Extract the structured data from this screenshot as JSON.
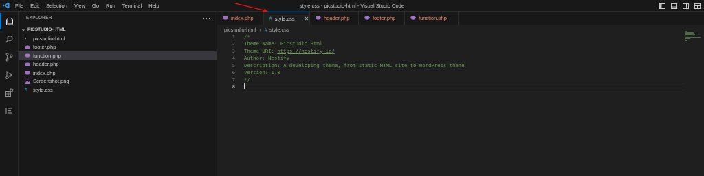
{
  "window": {
    "title": "style.css - picstudio-html - Visual Studio Code"
  },
  "menu": [
    "File",
    "Edit",
    "Selection",
    "View",
    "Go",
    "Run",
    "Terminal",
    "Help"
  ],
  "sidebar": {
    "title": "EXPLORER",
    "more": "···",
    "folder": "PICSTUDIO-HTML",
    "items": [
      {
        "label": "picstudio-html",
        "icon": "chevron-right-icon"
      },
      {
        "label": "footer.php",
        "icon": "php-icon"
      },
      {
        "label": "function.php",
        "icon": "php-icon"
      },
      {
        "label": "header.php",
        "icon": "php-icon"
      },
      {
        "label": "index.php",
        "icon": "php-icon"
      },
      {
        "label": "Screenshot.png",
        "icon": "image-icon"
      },
      {
        "label": "style.css",
        "icon": "css-icon"
      }
    ]
  },
  "tabs": [
    {
      "label": "index.php",
      "type": "php"
    },
    {
      "label": "style.css",
      "type": "css",
      "active": true
    },
    {
      "label": "header.php",
      "type": "php"
    },
    {
      "label": "footer.php",
      "type": "php"
    },
    {
      "label": "function.php",
      "type": "php"
    }
  ],
  "breadcrumb": {
    "folder": "picstudio-html",
    "file": "style.css"
  },
  "editor": {
    "lines": [
      {
        "num": "1",
        "text": "/*"
      },
      {
        "num": "2",
        "text": "Theme Name: Picstudio Html"
      },
      {
        "num": "3",
        "text_prefix": "Theme URI: ",
        "link": "https://nestify.io/"
      },
      {
        "num": "4",
        "text": "Author: Nestify"
      },
      {
        "num": "5",
        "text": "Description: A developing theme, from static HTML site to WordPress theme"
      },
      {
        "num": "6",
        "text": "Version: 1.0"
      },
      {
        "num": "7",
        "text": "*/"
      },
      {
        "num": "8",
        "text": ""
      }
    ]
  },
  "colors": {
    "accent": "#0078d4",
    "comment": "#6a9955",
    "php_tab": "#f48771",
    "php_icon": "#a074c4",
    "css_icon": "#519aba",
    "annotation_arrow": "#e51400"
  }
}
